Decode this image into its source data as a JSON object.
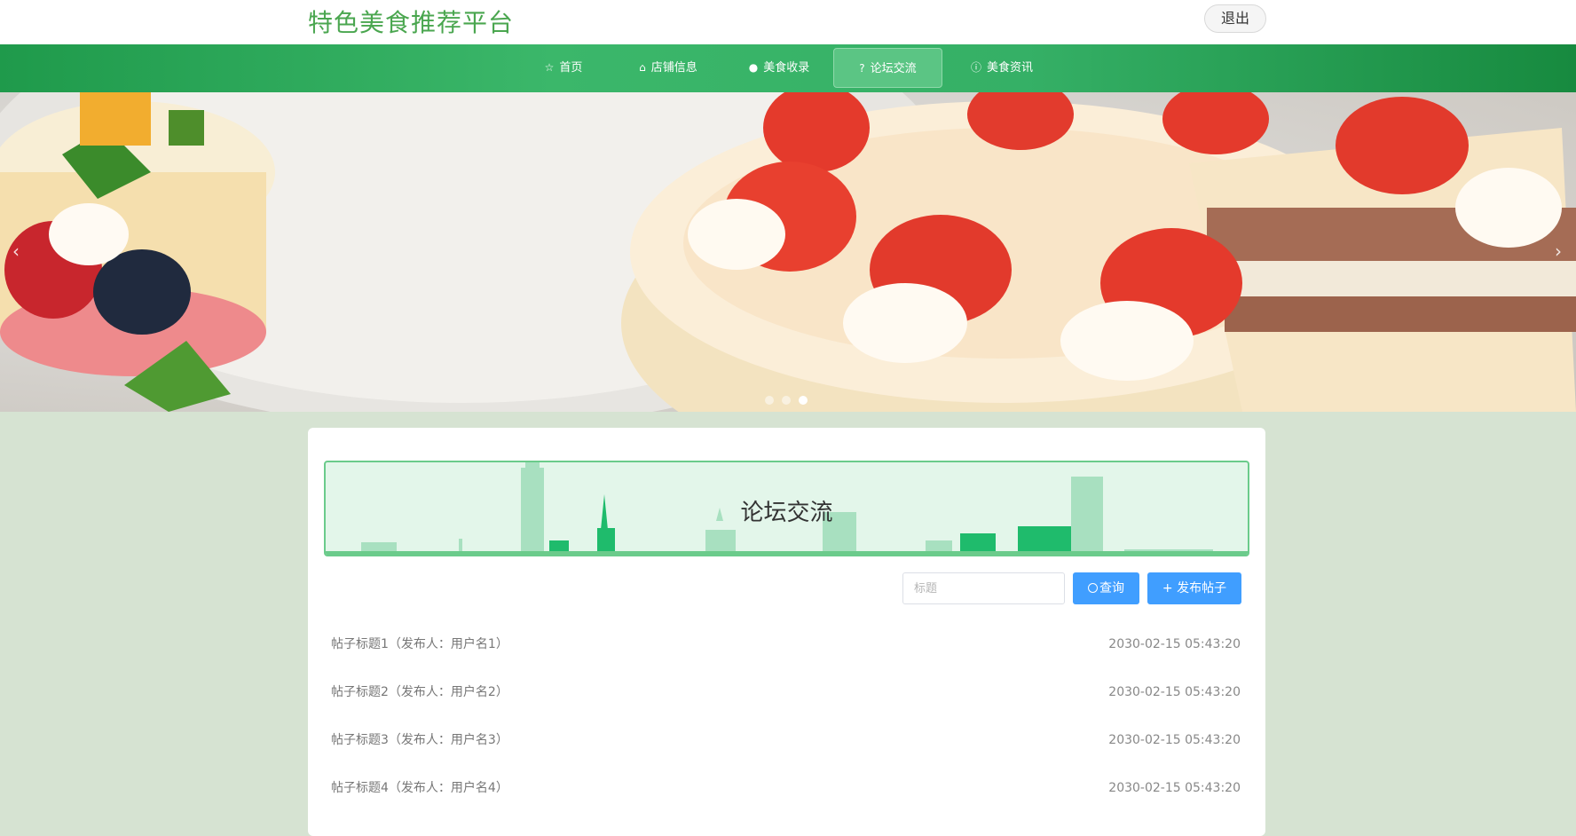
{
  "header": {
    "site_title": "特色美食推荐平台",
    "logout_label": "退出"
  },
  "nav": {
    "items": [
      {
        "label": "首页",
        "icon": "star-icon"
      },
      {
        "label": "店铺信息",
        "icon": "shop-icon"
      },
      {
        "label": "美食收录",
        "icon": "info-circle-icon"
      },
      {
        "label": "论坛交流",
        "icon": "question-circle-icon",
        "active": true
      },
      {
        "label": "美食资讯",
        "icon": "info-icon"
      }
    ]
  },
  "banner": {
    "image": "strawberry-cake-photo",
    "prev_arrow": "‹",
    "next_arrow": "›",
    "slide_count": 3,
    "active_slide": 3
  },
  "forum": {
    "title": "论坛交流",
    "search_placeholder": "标题",
    "search_value": "",
    "search_button": "查询",
    "post_button": "+ 发布帖子",
    "posts": [
      {
        "title": "帖子标题1（发布人：用户名1）",
        "time": "2030-02-15 05:43:20"
      },
      {
        "title": "帖子标题2（发布人：用户名2）",
        "time": "2030-02-15 05:43:20"
      },
      {
        "title": "帖子标题3（发布人：用户名3）",
        "time": "2030-02-15 05:43:20"
      },
      {
        "title": "帖子标题4（发布人：用户名4）",
        "time": "2030-02-15 05:43:20"
      }
    ]
  },
  "colors": {
    "brand_green": "#4aa64f",
    "nav_green": "#35b066",
    "button_blue": "#409eff",
    "page_bg": "#d6e3d2"
  }
}
